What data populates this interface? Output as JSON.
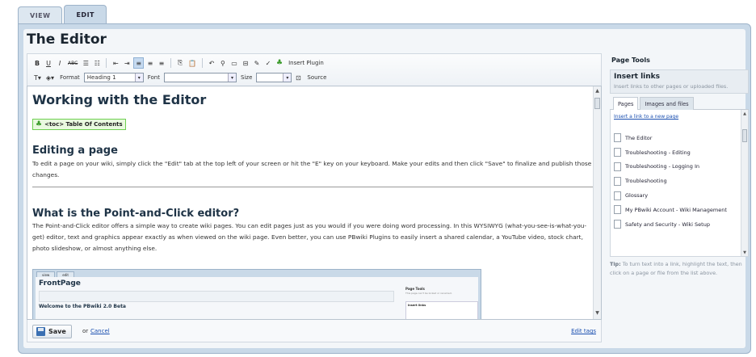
{
  "tabs": [
    {
      "label": "VIEW"
    },
    {
      "label": "EDIT"
    }
  ],
  "page_title": "The Editor",
  "toolbar": {
    "bold": "B",
    "underline": "U",
    "italic": "I",
    "strike": "ABC",
    "insert_plugin": "Insert Plugin",
    "format_label": "Format",
    "format_value": "Heading 1",
    "font_label": "Font",
    "font_value": "",
    "size_label": "Size",
    "size_value": "",
    "source_label": "Source"
  },
  "editor": {
    "h1": "Working with the Editor",
    "toc": "<toc> Table Of Contents",
    "h2a": "Editing a page",
    "p1": "To edit a page on your wiki, simply click the \"Edit\" tab at the top left of your screen or hit the \"E\" key on your keyboard.  Make your edits and then click \"Save\" to finalize and publish those changes.",
    "h2b": "What is the Point-and-Click editor?",
    "p2": "The Point-and-Click editor offers a simple way to create wiki pages. You can edit pages just as you would if you were doing word processing. In this WYSIWYG (what-you-see-is-what-you-get) editor, text and graphics appear exactly as when viewed on the wiki page. Even better, you can use PBwiki Plugins to easily insert a shared calendar, a YouTube video, stock chart, photo slideshow, or almost anything else.",
    "embedded": {
      "tab_view": "view",
      "tab_edit": "edit",
      "title": "FrontPage",
      "heading": "Welcome to the PBwiki 2.0 Beta",
      "side_title": "Page Tools",
      "side_sub": "This page can't be locked or renamed.",
      "insert_links": "Insert links"
    }
  },
  "bottom": {
    "save_label": "Save",
    "or_text": "or",
    "cancel_label": "Cancel",
    "edit_tags": "Edit tags"
  },
  "sidebar": {
    "title": "Page Tools",
    "insert_links_title": "Insert links",
    "insert_links_sub": "Insert links to other pages or uploaded files.",
    "tab_pages": "Pages",
    "tab_images": "Images and files",
    "new_page_link": "Insert a link to a new page",
    "pages": [
      "The Editor",
      "Troubleshooting - Editing",
      "Troubleshooting - Logging In",
      "Troubleshooting",
      "Glossary",
      "My PBwiki Account - Wiki Management",
      "Safety and Security - Wiki Setup"
    ],
    "tip_label": "Tip:",
    "tip_text": "To turn text into a link, highlight the text, then click on a page or file from the list above."
  }
}
